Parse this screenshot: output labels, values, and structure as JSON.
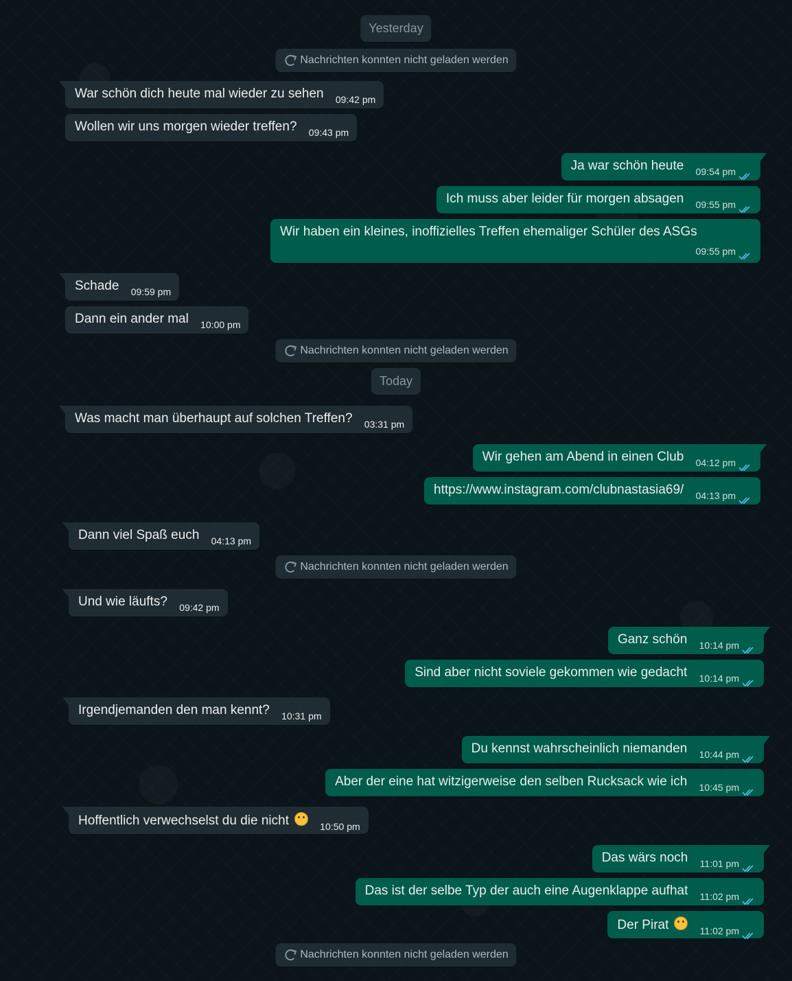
{
  "colors": {
    "background": "#0b141a",
    "incoming_bubble": "#202c33",
    "outgoing_bubble": "#005c4b",
    "read_ticks": "#53bdeb",
    "system_pill": "#1f2c33"
  },
  "day_labels": {
    "yesterday": "Yesterday",
    "today": "Today"
  },
  "notices": {
    "text": "Nachrichten konnten nicht geladen werden",
    "icon": "reload-icon"
  },
  "messages": [
    {
      "dir": "in",
      "text": "War schön dich heute mal wieder zu sehen",
      "time": "09:42 pm"
    },
    {
      "dir": "in",
      "text": "Wollen wir uns morgen wieder treffen?",
      "time": "09:43 pm"
    },
    {
      "dir": "out",
      "text": "Ja war schön heute",
      "time": "09:54 pm",
      "status": "read"
    },
    {
      "dir": "out",
      "text": "Ich muss aber leider für morgen absagen",
      "time": "09:55 pm",
      "status": "read"
    },
    {
      "dir": "out",
      "text": "Wir haben ein kleines, inoffizielles Treffen ehemaliger Schüler des ASGs",
      "time": "09:55 pm",
      "status": "read"
    },
    {
      "dir": "in",
      "text": "Schade",
      "time": "09:59 pm"
    },
    {
      "dir": "in",
      "text": "Dann ein ander mal",
      "time": "10:00 pm"
    },
    {
      "dir": "in",
      "text": "Was macht man überhaupt auf solchen Treffen?",
      "time": "03:31 pm"
    },
    {
      "dir": "out",
      "text": "Wir gehen am Abend in einen Club",
      "time": "04:12 pm",
      "status": "read"
    },
    {
      "dir": "out",
      "text": "https://www.instagram.com/clubnastasia69/",
      "time": "04:13 pm",
      "status": "read"
    },
    {
      "dir": "in",
      "text": "Dann viel Spaß euch",
      "time": "04:13 pm"
    },
    {
      "dir": "in",
      "text": "Und wie läufts?",
      "time": "09:42 pm"
    },
    {
      "dir": "out",
      "text": "Ganz schön",
      "time": "10:14 pm",
      "status": "read"
    },
    {
      "dir": "out",
      "text": "Sind aber nicht soviele gekommen wie gedacht",
      "time": "10:14 pm",
      "status": "read"
    },
    {
      "dir": "in",
      "text": "Irgendjemanden den man kennt?",
      "time": "10:31 pm"
    },
    {
      "dir": "out",
      "text": "Du kennst wahrscheinlich niemanden",
      "time": "10:44 pm",
      "status": "read"
    },
    {
      "dir": "out",
      "text": "Aber der eine hat witzigerweise den selben Rucksack wie ich",
      "time": "10:45 pm",
      "status": "read"
    },
    {
      "dir": "in",
      "text": "Hoffentlich verwechselst du die nicht",
      "time": "10:50 pm",
      "emoji": "rolling-on-floor-laughing-emoji"
    },
    {
      "dir": "out",
      "text": "Das wärs noch",
      "time": "11:01 pm",
      "status": "read"
    },
    {
      "dir": "out",
      "text": "Das ist der selbe Typ der auch eine Augenklappe aufhat",
      "time": "11:02 pm",
      "status": "read"
    },
    {
      "dir": "out",
      "text": "Der Pirat",
      "time": "11:02 pm",
      "status": "read",
      "emoji": "rolling-on-floor-laughing-emoji"
    }
  ]
}
